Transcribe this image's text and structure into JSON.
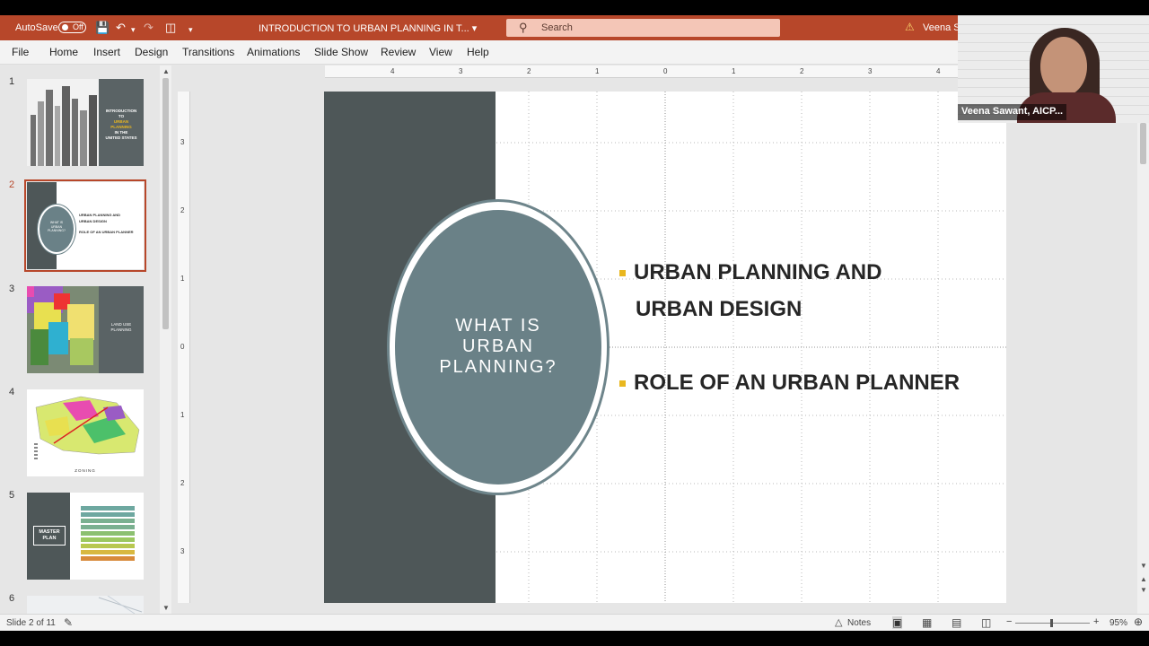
{
  "titlebar": {
    "autosave_label": "AutoSave",
    "autosave_state": "Off",
    "doc_title": "INTRODUCTION TO URBAN PLANNING IN T...",
    "search_placeholder": "Search",
    "user_name": "Veena Sa"
  },
  "tabs": [
    "File",
    "Home",
    "Insert",
    "Design",
    "Transitions",
    "Animations",
    "Slide Show",
    "Review",
    "View",
    "Help"
  ],
  "thumbnails": [
    {
      "num": "1",
      "title_lines": [
        "INTRODUCTION",
        "TO",
        "URBAN",
        "PLANNING",
        "IN THE",
        "UNITED STATES"
      ]
    },
    {
      "num": "2",
      "circle_lines": [
        "WHAT IS",
        "URBAN",
        "PLANNING?"
      ],
      "bullets": [
        "URBAN PLANNING AND",
        "URBAN DESIGN",
        "ROLE OF AN URBAN PLANNER"
      ]
    },
    {
      "num": "3",
      "caption_lines": [
        "LAND USE",
        "PLANNING"
      ]
    },
    {
      "num": "4",
      "caption": "ZONING"
    },
    {
      "num": "5",
      "box_lines": [
        "MASTER",
        "PLAN"
      ]
    },
    {
      "num": "6"
    }
  ],
  "ruler": {
    "h_labels": [
      "4",
      "3",
      "2",
      "1",
      "0",
      "1",
      "2",
      "3",
      "4"
    ],
    "v_labels": [
      "3",
      "2",
      "1",
      "0",
      "1",
      "2",
      "3"
    ]
  },
  "slide": {
    "circle_lines": [
      "WHAT IS",
      "URBAN",
      "PLANNING?"
    ],
    "bullet1_line1": "URBAN PLANNING AND",
    "bullet1_line2": "URBAN DESIGN",
    "bullet2": "ROLE OF AN URBAN PLANNER"
  },
  "video": {
    "name": "Veena Sawant, AICP..."
  },
  "statusbar": {
    "slide_info": "Slide 2 of 11",
    "notes_label": "Notes",
    "zoom": "95%"
  },
  "colors": {
    "accent": "#b7472a",
    "slide_dark": "#4e5758",
    "ellipse": "#6a8187",
    "bullet": "#e9b71f"
  }
}
